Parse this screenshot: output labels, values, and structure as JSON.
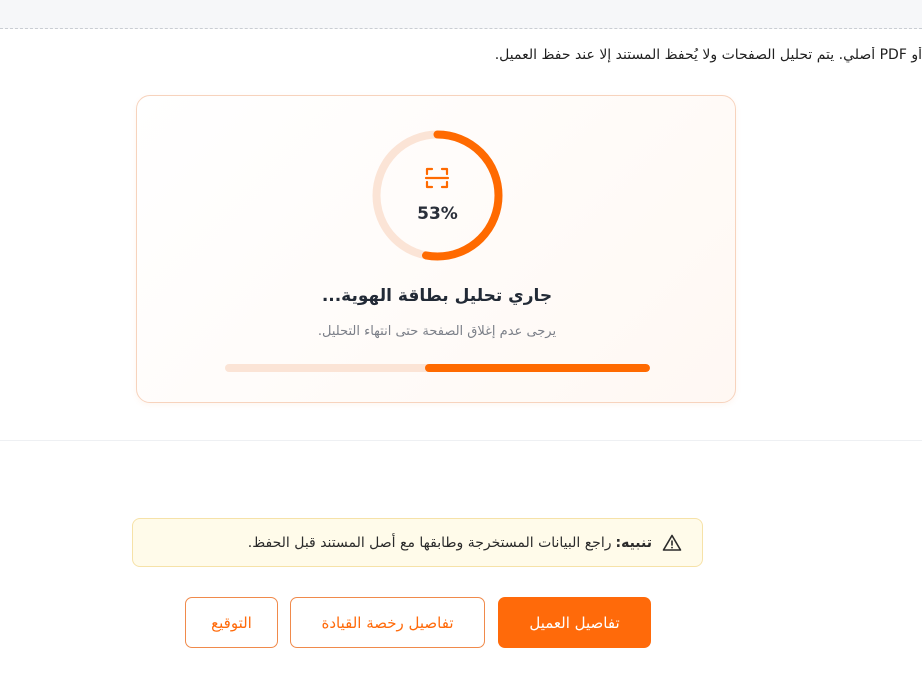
{
  "info": {
    "text": "أو PDF أصلي. يتم تحليل الصفحات ولا يُحفظ المستند إلا عند حفظ العميل."
  },
  "analysis": {
    "percent": 53,
    "percent_label": "53%",
    "title": "جاري تحليل بطاقة الهوية...",
    "subtitle": "يرجى عدم إغلاق الصفحة حتى انتهاء التحليل.",
    "icon": "scan-icon"
  },
  "alert": {
    "icon": "warning-icon",
    "label": "تنبيه:",
    "message": "راجع البيانات المستخرجة وطابقها مع أصل المستند قبل الحفظ."
  },
  "actions": {
    "customer_details": "تفاصيل العميل",
    "license_details": "تفاصيل رخصة القيادة",
    "signature": "التوقيع"
  },
  "colors": {
    "accent": "#ff6a00",
    "accent_light": "#fbe4d6",
    "alert_bg": "#fffbea",
    "alert_border": "#f6e2a8"
  }
}
